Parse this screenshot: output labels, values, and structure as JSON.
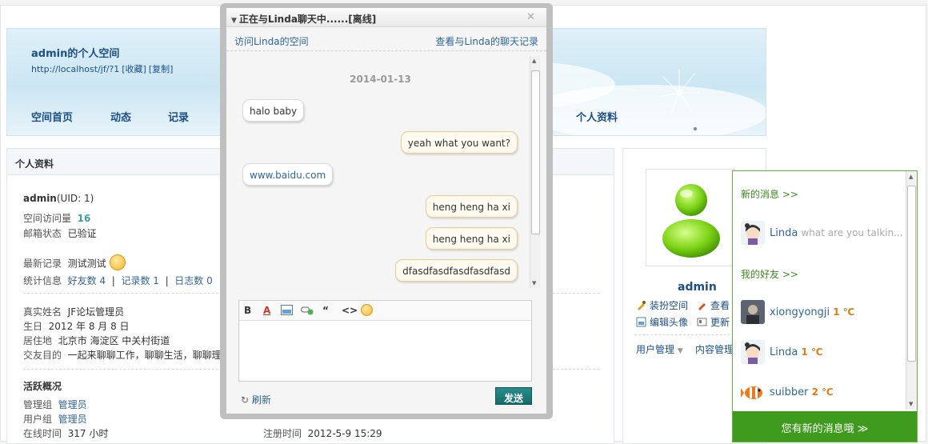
{
  "banner": {
    "space_title": "admin的个人空间",
    "space_url": "http://localhost/jf/?1",
    "bookmark_label": "[收藏]",
    "copy_label": "[复制]",
    "nav": [
      "空间首页",
      "动态",
      "记录",
      "个人资料"
    ]
  },
  "profile": {
    "header": "个人资料",
    "username": "admin",
    "uid": "(UID: 1)",
    "visits_label": "空间访问量",
    "visits_value": "16",
    "email_label": "邮箱状态",
    "email_value": "已验证",
    "latest_label": "最新记录",
    "latest_value": "测试测试",
    "stats_label": "统计信息",
    "friends_label": "好友数",
    "friends_value": "4",
    "records_label": "记录数",
    "records_value": "1",
    "logs_label": "日志数",
    "logs_value": "0",
    "realname_label": "真实姓名",
    "realname_value": "JF论坛管理员",
    "birthday_label": "生日",
    "birthday_value": "2012 年 8 月 8 日",
    "residence_label": "居住地",
    "residence_value": "北京市 海淀区 中关村街道",
    "purpose_label": "交友目的",
    "purpose_value": "一起来聊聊工作，聊聊生活，聊聊理想",
    "activity_title": "活跃概况",
    "admin_group_label": "管理组",
    "admin_group_value": "管理员",
    "user_group_label": "用户组",
    "user_group_value": "管理员",
    "online_label": "在线时间",
    "online_value": "317 小时",
    "register_label": "注册时间",
    "register_value": "2012-5-9 15:29"
  },
  "user_card": {
    "name": "admin",
    "dress_label": "装扮空间",
    "view_label": "查看",
    "avatar_label": "编辑头像",
    "update_label": "更新",
    "user_manage_label": "用户管理",
    "content_manage_label": "内容管理"
  },
  "chat": {
    "title": "正在与Linda聊天中......[离线]",
    "visit_link": "访问Linda的空间",
    "history_link": "查看与Linda的聊天记录",
    "date": "2014-01-13",
    "messages": [
      {
        "side": "left",
        "text": "halo baby"
      },
      {
        "side": "right",
        "text": "yeah what you want?"
      },
      {
        "side": "left",
        "text": "www.baidu.com"
      },
      {
        "side": "right",
        "text": "heng heng ha xi"
      },
      {
        "side": "right",
        "text": "heng heng ha xi"
      },
      {
        "side": "right",
        "text": "dfasdfasdfasdfasdfasd"
      }
    ],
    "refresh_label": "刷新",
    "send_label": "发送"
  },
  "messenger": {
    "new_messages_title": "新的消息 >>",
    "friends_title": "我的好友 >>",
    "new_message": {
      "name": "Linda",
      "preview": "what are you talkin..."
    },
    "friends": [
      {
        "name": "xiongyongji",
        "temp": "1 ℃"
      },
      {
        "name": "Linda",
        "temp": "1 ℃"
      },
      {
        "name": "suibber",
        "temp": "2 ℃"
      }
    ],
    "bottom_bar": "您有新的消息哦 ≫"
  }
}
